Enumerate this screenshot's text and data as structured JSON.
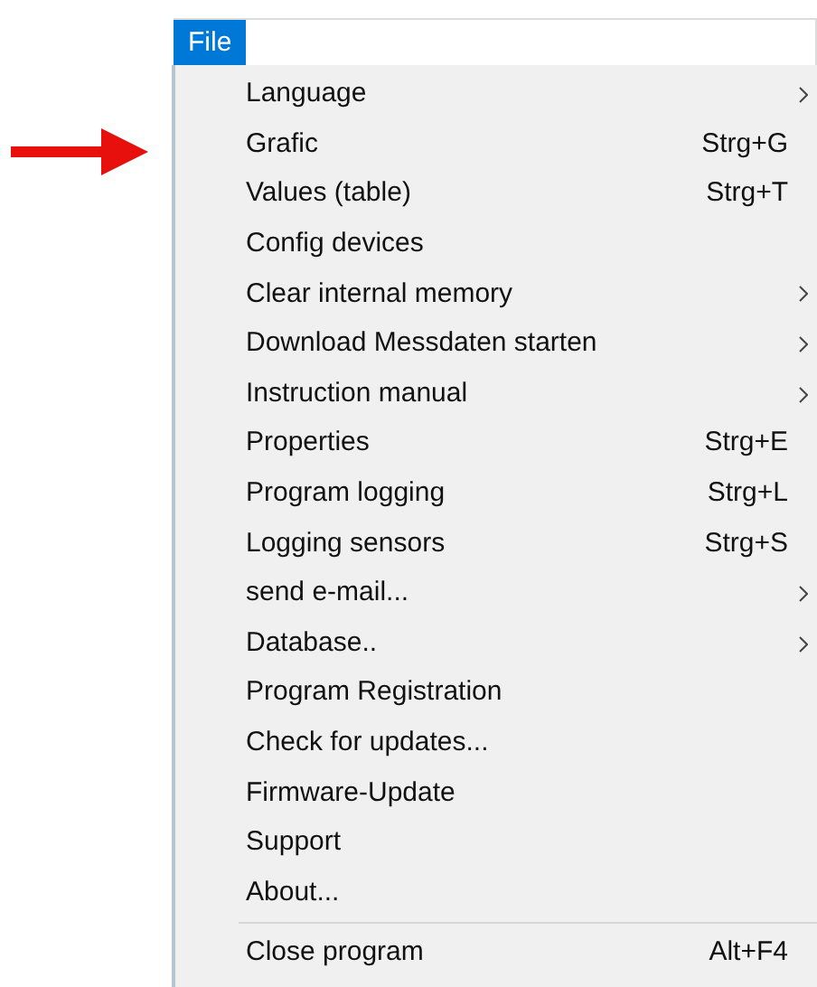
{
  "menu_bar": [
    {
      "label": "File",
      "selected": true
    }
  ],
  "menu": [
    {
      "kind": "item",
      "label": "Language",
      "submenu": true
    },
    {
      "kind": "item",
      "label": "Grafic",
      "shortcut": "Strg+G",
      "submenu": false
    },
    {
      "kind": "item",
      "label": "Values (table)",
      "shortcut": "Strg+T",
      "submenu": false
    },
    {
      "kind": "item",
      "label": "Config devices",
      "submenu": false
    },
    {
      "kind": "item",
      "label": "Clear internal memory",
      "submenu": true
    },
    {
      "kind": "item",
      "label": "Download Messdaten starten",
      "submenu": true
    },
    {
      "kind": "item",
      "label": "Instruction manual",
      "submenu": true
    },
    {
      "kind": "item",
      "label": "Properties",
      "shortcut": "Strg+E",
      "submenu": false
    },
    {
      "kind": "item",
      "label": "Program logging",
      "shortcut": "Strg+L",
      "submenu": false
    },
    {
      "kind": "item",
      "label": "Logging sensors",
      "shortcut": "Strg+S",
      "submenu": false
    },
    {
      "kind": "item",
      "label": "send e-mail...",
      "submenu": true
    },
    {
      "kind": "item",
      "label": "Database..",
      "submenu": true
    },
    {
      "kind": "item",
      "label": "Program Registration",
      "submenu": false
    },
    {
      "kind": "item",
      "label": "Check for updates...",
      "submenu": false
    },
    {
      "kind": "item",
      "label": "Firmware-Update",
      "submenu": false
    },
    {
      "kind": "item",
      "label": "Support",
      "submenu": false
    },
    {
      "kind": "item",
      "label": "About...",
      "submenu": false
    },
    {
      "kind": "separator"
    },
    {
      "kind": "item",
      "label": "Close program",
      "shortcut": "Alt+F4",
      "submenu": false
    }
  ]
}
